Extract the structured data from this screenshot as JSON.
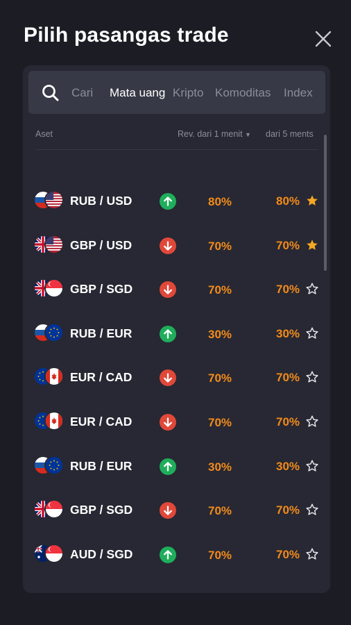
{
  "header": {
    "title": "Pilih pasangas trade"
  },
  "search": {
    "placeholder": "Cari"
  },
  "tabs": [
    {
      "label": "Mata uang",
      "active": true
    },
    {
      "label": "Kripto",
      "active": false
    },
    {
      "label": "Komoditas",
      "active": false
    },
    {
      "label": "Index",
      "active": false
    }
  ],
  "table": {
    "col_asset": "Aset",
    "col_rev1": "Rev. dari 1 menit",
    "col_rev5": "dari 5 ments"
  },
  "colors": {
    "accent_orange": "#f38b1a",
    "up_green": "#1fae5b",
    "down_red": "#e0483a",
    "star_gold": "#f5a623"
  },
  "rows": [
    {
      "pair": "RUB / USD",
      "flags": [
        "ru",
        "us"
      ],
      "trend": "up",
      "rev1": "80%",
      "rev5": "80%",
      "favorite": true
    },
    {
      "pair": "GBP / USD",
      "flags": [
        "gb",
        "us"
      ],
      "trend": "down",
      "rev1": "70%",
      "rev5": "70%",
      "favorite": true
    },
    {
      "pair": "GBP / SGD",
      "flags": [
        "gb",
        "sg"
      ],
      "trend": "down",
      "rev1": "70%",
      "rev5": "70%",
      "favorite": false
    },
    {
      "pair": "RUB / EUR",
      "flags": [
        "ru",
        "eu"
      ],
      "trend": "up",
      "rev1": "30%",
      "rev5": "30%",
      "favorite": false
    },
    {
      "pair": "EUR / CAD",
      "flags": [
        "eu",
        "ca"
      ],
      "trend": "down",
      "rev1": "70%",
      "rev5": "70%",
      "favorite": false
    },
    {
      "pair": "EUR / CAD",
      "flags": [
        "eu",
        "ca"
      ],
      "trend": "down",
      "rev1": "70%",
      "rev5": "70%",
      "favorite": false
    },
    {
      "pair": "RUB / EUR",
      "flags": [
        "ru",
        "eu"
      ],
      "trend": "up",
      "rev1": "30%",
      "rev5": "30%",
      "favorite": false
    },
    {
      "pair": "GBP / SGD",
      "flags": [
        "gb",
        "sg"
      ],
      "trend": "down",
      "rev1": "70%",
      "rev5": "70%",
      "favorite": false
    },
    {
      "pair": "AUD / SGD",
      "flags": [
        "au",
        "sg"
      ],
      "trend": "up",
      "rev1": "70%",
      "rev5": "70%",
      "favorite": false
    }
  ]
}
